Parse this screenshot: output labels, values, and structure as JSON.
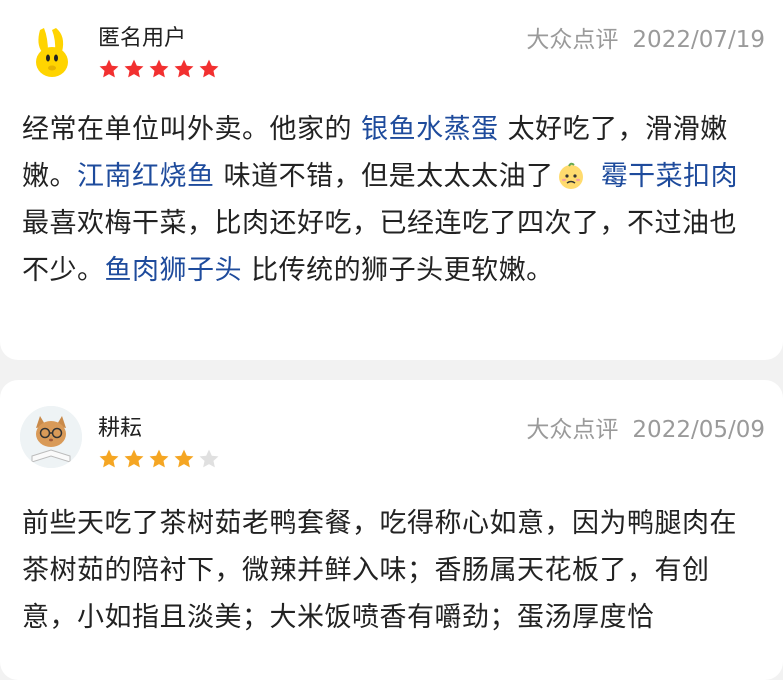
{
  "reviews": [
    {
      "user": "匿名用户",
      "source": "大众点评",
      "date": "2022/07/19",
      "rating": 5,
      "avatar_icon": "yellow-bunny-avatar",
      "segments": [
        {
          "text": "经常在单位叫外卖。他家的 ",
          "dish": false
        },
        {
          "text": "银鱼水蒸蛋",
          "dish": true
        },
        {
          "text": " 太好吃了，滑滑嫩嫩。",
          "dish": false
        },
        {
          "text": "江南红烧鱼",
          "dish": true
        },
        {
          "text": " 味道不错，但是太太太油了",
          "dish": false
        },
        {
          "emoji": "worried-face-emoji"
        },
        {
          "text": " ",
          "dish": false
        },
        {
          "text": "霉干菜扣肉",
          "dish": true
        },
        {
          "text": " 最喜欢梅干菜，比肉还好吃，已经连吃了四次了，不过油也不少。",
          "dish": false
        },
        {
          "text": "鱼肉狮子头",
          "dish": true
        },
        {
          "text": " 比传统的狮子头更软嫩。",
          "dish": false
        }
      ]
    },
    {
      "user": "耕耘",
      "source": "大众点评",
      "date": "2022/05/09",
      "rating": 4,
      "avatar_icon": "kitten-reading-avatar",
      "segments": [
        {
          "text": "前些天吃了茶树茹老鸭套餐，吃得称心如意，因为鸭腿肉在茶树茹的陪衬下，微辣并鲜入味；香肠属天花板了，有创意，小如指且淡美；大米饭喷香有嚼劲；蛋汤厚度恰",
          "dish": false
        }
      ]
    }
  ],
  "colors": {
    "dish_link": "#1e4b9c",
    "star_on": "#f23030",
    "star_on_card2": "#f5a623",
    "star_off": "#e0e0e0",
    "meta_text": "#9a9a9a"
  }
}
